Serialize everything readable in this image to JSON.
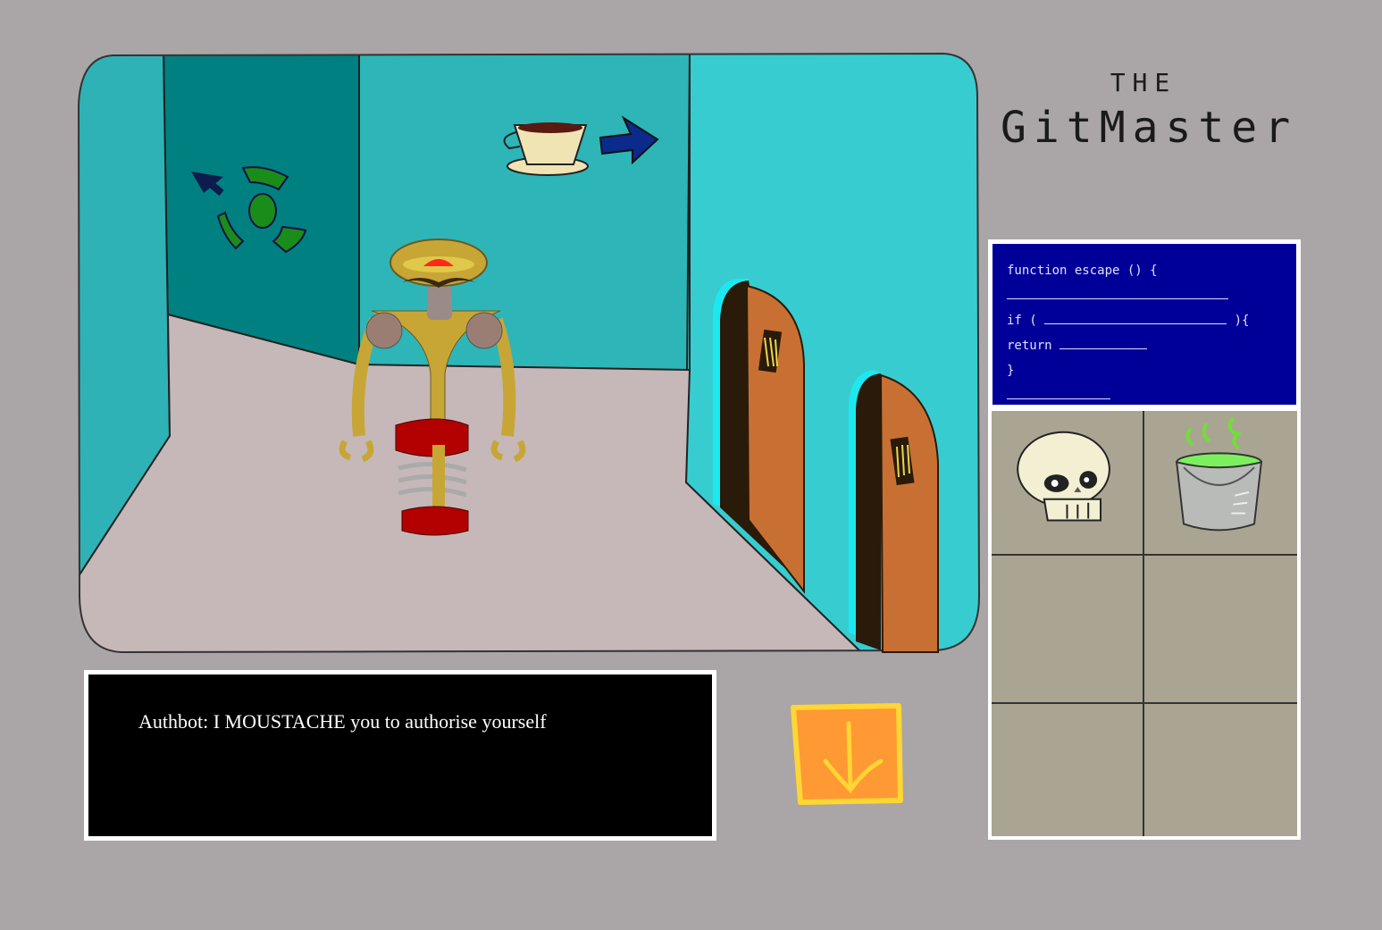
{
  "title": {
    "the": "THE",
    "main": "GitMaster"
  },
  "code_panel": {
    "lines": [
      "function escape () {",
      "if (",
      "){",
      "return",
      "}"
    ]
  },
  "inventory": {
    "items": [
      {
        "icon": "skull-icon"
      },
      {
        "icon": "slime-bucket-icon"
      },
      null,
      null,
      null,
      null
    ]
  },
  "dialog": {
    "text": "Authbot: I MOUSTACHE you to authorise yourself"
  },
  "next_button": {
    "icon": "down-arrow-icon"
  },
  "scene": {
    "signs": [
      "recycle-sign-icon",
      "coffee-sign-icon"
    ],
    "character": "authbot-robot",
    "doors": 2
  },
  "colors": {
    "background": "#aaa5a6",
    "wall_dark": "#008080",
    "wall_mid": "#2db5b8",
    "wall_light": "#37cdd0",
    "floor": "#c6b8b8",
    "code_bg": "#000099",
    "inventory_bg": "#aaa593",
    "button_orange": "#ff9933",
    "button_border": "#ffd633"
  }
}
